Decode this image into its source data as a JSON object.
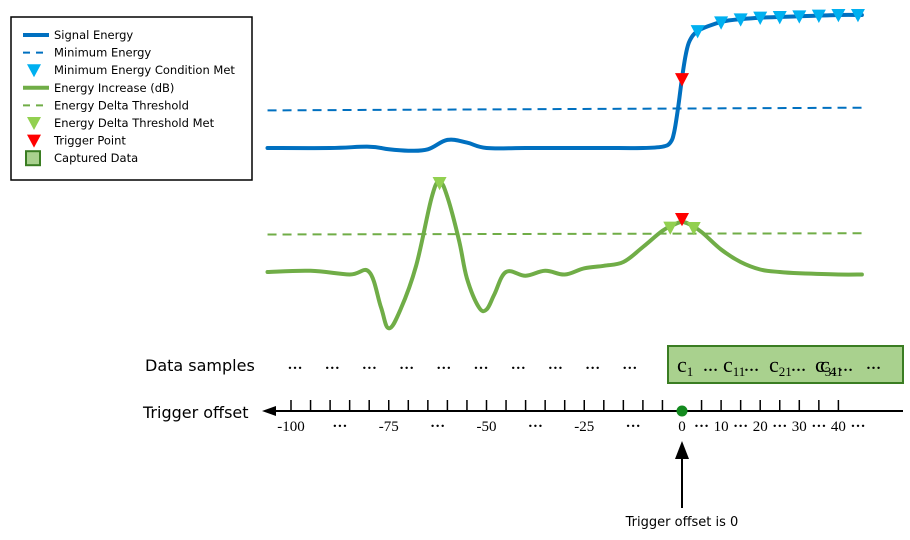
{
  "legend": {
    "items": [
      {
        "label": "Signal Energy",
        "symbol": "solid-line",
        "color": "#0070C0"
      },
      {
        "label": "Minimum Energy",
        "symbol": "dashed-line",
        "color": "#0070C0"
      },
      {
        "label": "Minimum Energy Condition Met",
        "symbol": "down-triangle",
        "color": "#00B0F0"
      },
      {
        "label": "Energy Increase (dB)",
        "symbol": "solid-line",
        "color": "#70AD47"
      },
      {
        "label": "Energy Delta Threshold",
        "symbol": "dashed-line",
        "color": "#70AD47"
      },
      {
        "label": "Energy Delta Threshold Met",
        "symbol": "down-triangle",
        "color": "#92D050"
      },
      {
        "label": "Trigger Point",
        "symbol": "down-triangle",
        "color": "#FF0000"
      },
      {
        "label": "Captured Data",
        "symbol": "filled-square",
        "color": "#A9D18E",
        "border": "#3A7D22"
      }
    ]
  },
  "colors": {
    "signal": "#0070C0",
    "min_condition": "#00B0F0",
    "delta": "#70AD47",
    "delta_met": "#92D050",
    "trigger": "#FF0000",
    "captured_fill": "#A9D18E",
    "captured_border": "#3A7D22",
    "trigger_dot": "#138A1E"
  },
  "chart_data": {
    "type": "line",
    "title": "",
    "xlabel": "Trigger offset",
    "ylabel": "",
    "x_range": [
      -100,
      46
    ],
    "series": [
      {
        "name": "Signal Energy",
        "x": [
          -106,
          -90,
          -80,
          -75,
          -70,
          -65,
          -60,
          -55,
          -50,
          -40,
          -30,
          -20,
          -10,
          -5,
          -3,
          -2,
          -1,
          0,
          1,
          2,
          4,
          8,
          12,
          20,
          30,
          40,
          46
        ],
        "y": [
          0.1,
          0.1,
          0.11,
          0.09,
          0.08,
          0.09,
          0.16,
          0.14,
          0.1,
          0.1,
          0.1,
          0.1,
          0.1,
          0.11,
          0.14,
          0.22,
          0.4,
          0.62,
          0.8,
          0.9,
          0.97,
          1.02,
          1.05,
          1.07,
          1.08,
          1.09,
          1.09
        ]
      },
      {
        "name": "Minimum Energy",
        "x": [
          -106,
          46
        ],
        "y": [
          0.38,
          0.4
        ]
      },
      {
        "name": "Energy Increase (dB)",
        "x": [
          -106,
          -95,
          -85,
          -80,
          -77,
          -75,
          -72,
          -68,
          -64,
          -62,
          -60,
          -57,
          -55,
          -52,
          -50,
          -48,
          -45,
          -40,
          -35,
          -30,
          -25,
          -20,
          -15,
          -10,
          -5,
          -2,
          0,
          2,
          5,
          10,
          15,
          20,
          25,
          30,
          40,
          46
        ],
        "y": [
          0.0,
          0.01,
          -0.02,
          0.0,
          -0.28,
          -0.45,
          -0.3,
          0.05,
          0.6,
          0.72,
          0.6,
          0.25,
          -0.05,
          -0.28,
          -0.3,
          -0.18,
          0.0,
          -0.03,
          0.01,
          -0.02,
          0.03,
          0.05,
          0.08,
          0.2,
          0.33,
          0.38,
          0.4,
          0.38,
          0.32,
          0.18,
          0.08,
          0.02,
          0.0,
          -0.01,
          -0.02,
          -0.02
        ]
      },
      {
        "name": "Energy Delta Threshold",
        "x": [
          -106,
          46
        ],
        "y": [
          0.3,
          0.31
        ]
      }
    ],
    "markers": {
      "min_energy_condition_met": [
        4,
        10,
        15,
        20,
        25,
        30,
        35,
        40,
        45
      ],
      "energy_delta_threshold_met": [
        -62,
        -3,
        3
      ],
      "trigger_point": [
        0
      ]
    },
    "axis": {
      "ticks_major_labels": [
        "-100",
        "...",
        "-75",
        "...",
        "-50",
        "...",
        "-25",
        "...",
        "0",
        "...",
        "10",
        "...",
        "20",
        "...",
        "30",
        "...",
        "40",
        "..."
      ],
      "tick_step": 5
    }
  },
  "labels": {
    "data_samples": "Data samples",
    "trigger_offset": "Trigger offset",
    "trigger_note": "Trigger offset is 0",
    "ellipsis": "…",
    "small_ellipsis": "…"
  },
  "captured": {
    "samples": [
      {
        "base": "c",
        "sub": "1"
      },
      {
        "base": "c",
        "sub": "11"
      },
      {
        "base": "c",
        "sub": "21"
      },
      {
        "base": "c",
        "sub": "31"
      },
      {
        "base": "c",
        "sub": "41"
      }
    ]
  },
  "data_samples_placeholders": 10,
  "axis_labels": [
    {
      "text": "-100",
      "at": -100
    },
    {
      "text": "…",
      "at": -87.5,
      "dots": true
    },
    {
      "text": "-75",
      "at": -75
    },
    {
      "text": "…",
      "at": -62.5,
      "dots": true
    },
    {
      "text": "-50",
      "at": -50
    },
    {
      "text": "…",
      "at": -37.5,
      "dots": true
    },
    {
      "text": "-25",
      "at": -25
    },
    {
      "text": "…",
      "at": -12.5,
      "dots": true
    },
    {
      "text": "0",
      "at": 0
    },
    {
      "text": "…",
      "at": 5,
      "dots": true
    },
    {
      "text": "10",
      "at": 10
    },
    {
      "text": "…",
      "at": 15,
      "dots": true
    },
    {
      "text": "20",
      "at": 20
    },
    {
      "text": "…",
      "at": 25,
      "dots": true
    },
    {
      "text": "30",
      "at": 30
    },
    {
      "text": "…",
      "at": 35,
      "dots": true
    },
    {
      "text": "40",
      "at": 40
    },
    {
      "text": "…",
      "at": 45,
      "dots": true
    }
  ]
}
